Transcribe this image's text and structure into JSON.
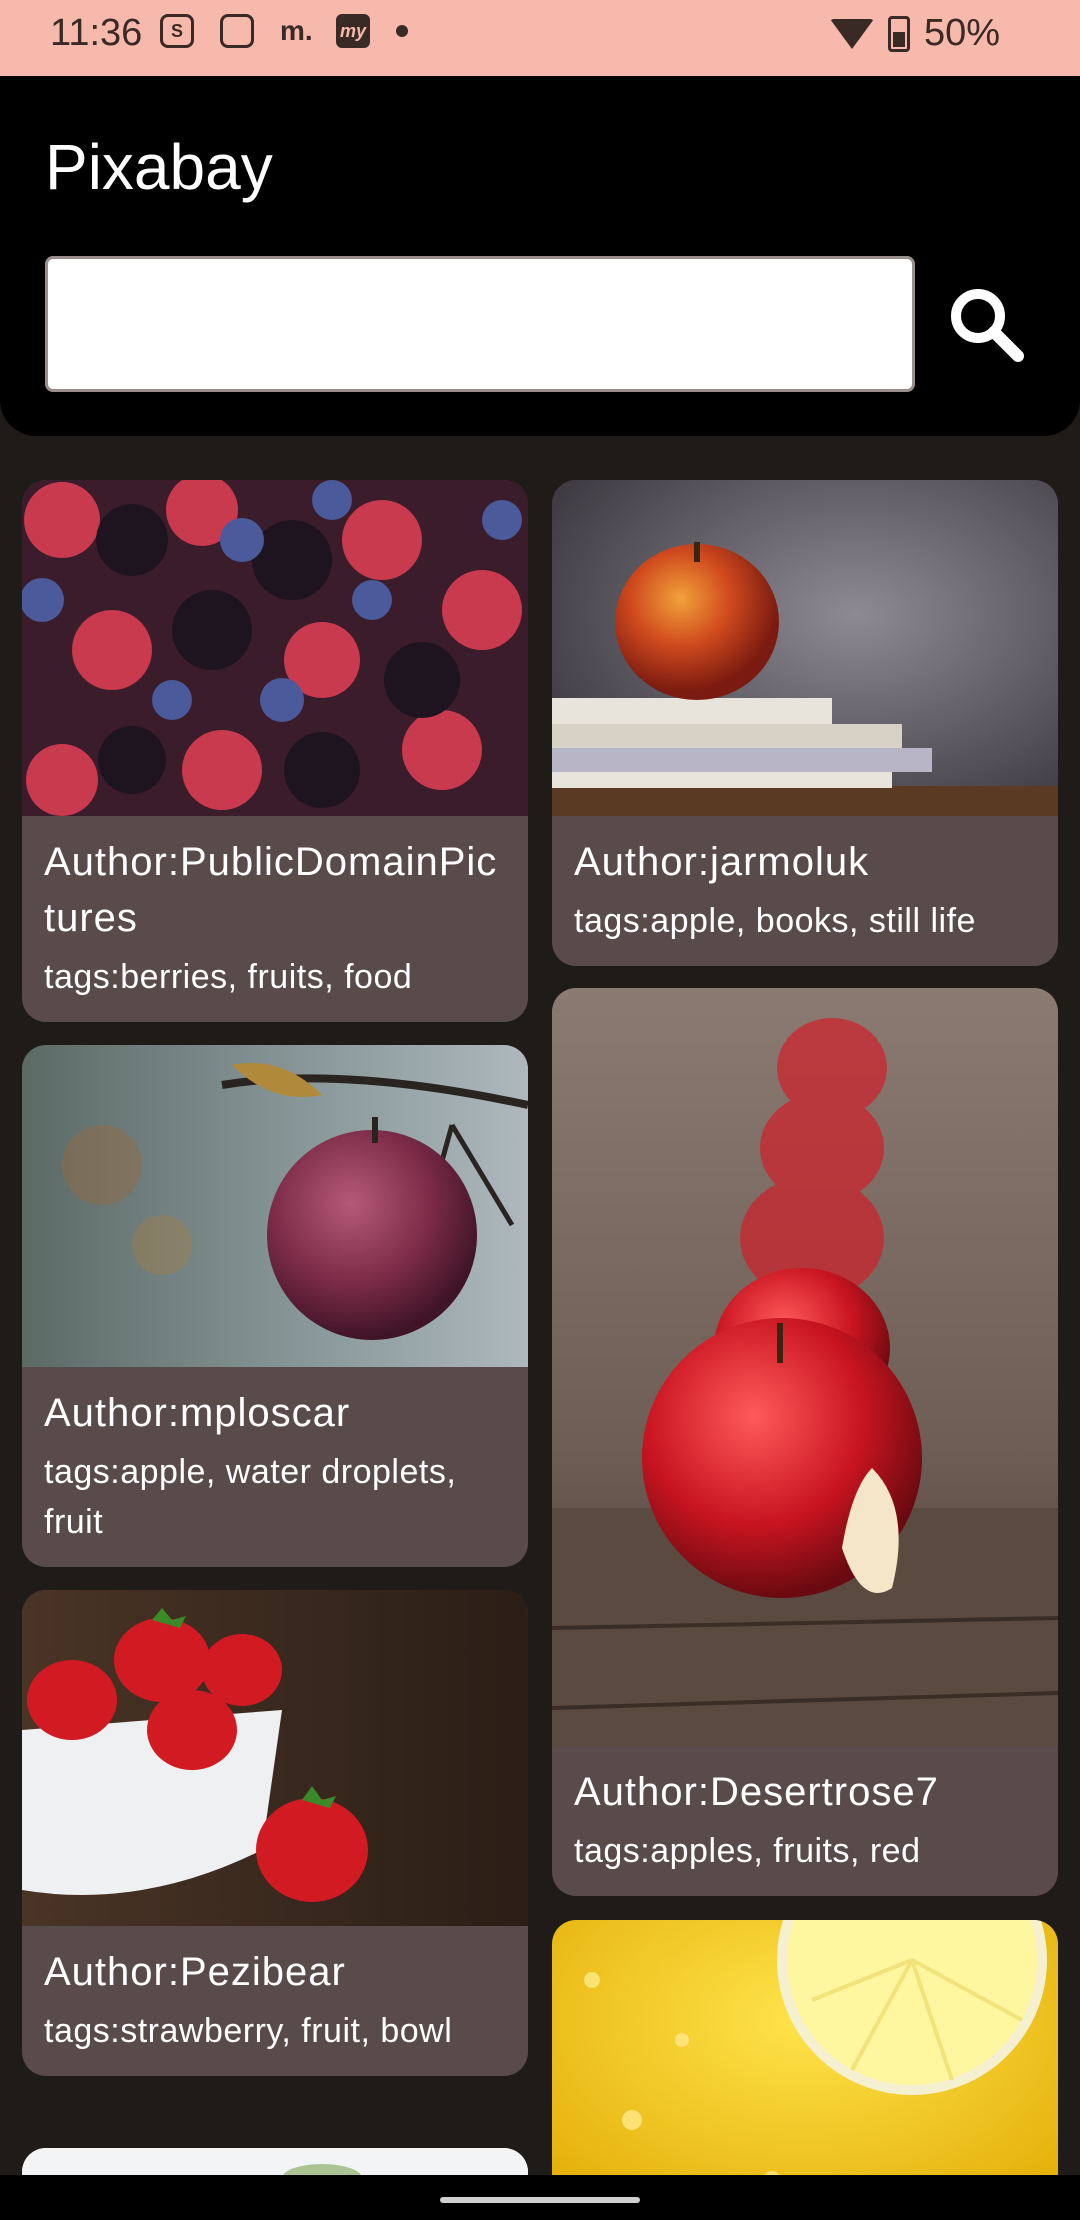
{
  "status_bar": {
    "time": "11:36",
    "left_icons": [
      "sim-icon",
      "watch-icon",
      "m-app-icon",
      "my-app-icon",
      "dot-icon"
    ],
    "battery": "50%"
  },
  "app": {
    "title": "Pixabay",
    "search": {
      "value": "",
      "placeholder": ""
    }
  },
  "cards": [
    {
      "author": "Author:PublicDomainPictures",
      "tags": "tags:berries, fruits, food",
      "image": "berries"
    },
    {
      "author": "Author:jarmoluk",
      "tags": "tags:apple, books, still life",
      "image": "apple-books"
    },
    {
      "author": "Author:mploscar",
      "tags": "tags:apple, water droplets, fruit",
      "image": "apple-branch"
    },
    {
      "author": "Author:Desertrose7",
      "tags": "tags:apples, fruits, red",
      "image": "apples-row"
    },
    {
      "author": "Author:Pezibear",
      "tags": "tags:strawberry, fruit, bowl",
      "image": "strawberries"
    },
    {
      "author": "",
      "tags": "",
      "image": "lemon"
    }
  ],
  "colors": {
    "status_bar_bg": "#f8b9ad",
    "app_bar_bg": "#000000",
    "background": "#1f1b19",
    "card_bg": "#584b4a"
  }
}
